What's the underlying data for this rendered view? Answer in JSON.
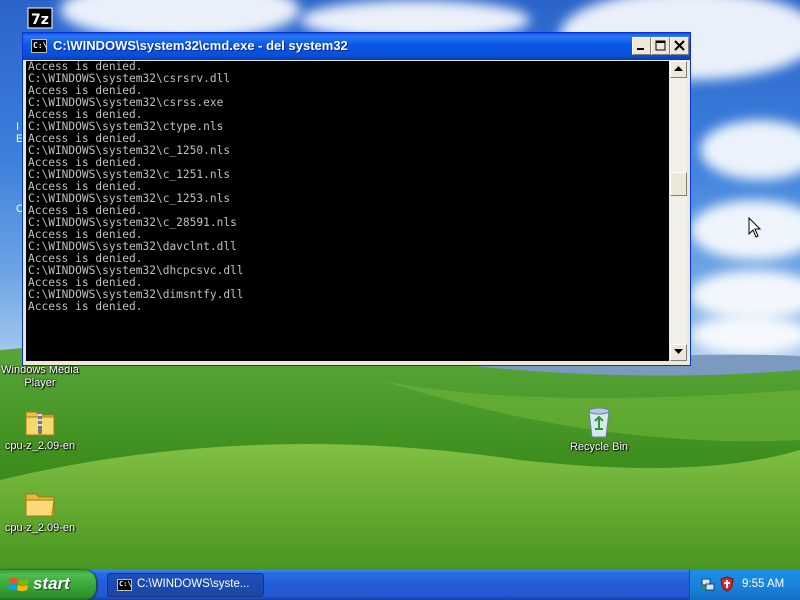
{
  "desktop": {
    "icons": [
      {
        "name": "7z",
        "label": ""
      },
      {
        "name": "windows-media-player",
        "label": "Windows Media Player"
      },
      {
        "name": "cpu-z-zip",
        "label": "cpu-z_2.09-en"
      },
      {
        "name": "cpu-z-folder",
        "label": "cpu-z_2.09-en"
      },
      {
        "name": "recycle-bin",
        "label": "Recycle Bin"
      }
    ],
    "partial_icon_letters": [
      "I",
      "E",
      "C"
    ]
  },
  "cmd_window": {
    "title": "C:\\WINDOWS\\system32\\cmd.exe - del system32",
    "icon_text": "C:\\",
    "console_text": "Access is denied.\nC:\\WINDOWS\\system32\\csrsrv.dll\nAccess is denied.\nC:\\WINDOWS\\system32\\csrss.exe\nAccess is denied.\nC:\\WINDOWS\\system32\\ctype.nls\nAccess is denied.\nC:\\WINDOWS\\system32\\c_1250.nls\nAccess is denied.\nC:\\WINDOWS\\system32\\c_1251.nls\nAccess is denied.\nC:\\WINDOWS\\system32\\c_1253.nls\nAccess is denied.\nC:\\WINDOWS\\system32\\c_28591.nls\nAccess is denied.\nC:\\WINDOWS\\system32\\davclnt.dll\nAccess is denied.\nC:\\WINDOWS\\system32\\dhcpcsvc.dll\nAccess is denied.\nC:\\WINDOWS\\system32\\dimsntfy.dll\nAccess is denied."
  },
  "taskbar": {
    "start_label": "start",
    "task_item_label": "C:\\WINDOWS\\syste...",
    "clock": "9:55 AM"
  },
  "icons": {
    "start": "windows-flag-icon",
    "cmd": "command-prompt-icon",
    "tray": [
      "network-tray-icon",
      "security-shield-tray-icon"
    ],
    "cursor": "mouse-pointer-icon"
  },
  "colors": {
    "titlebar": "#0a58e6",
    "taskbar": "#245edb",
    "start_button": "#3aa83a",
    "console_bg": "#000000",
    "console_text": "#c0c0c0",
    "tray": "#1a84dc"
  }
}
